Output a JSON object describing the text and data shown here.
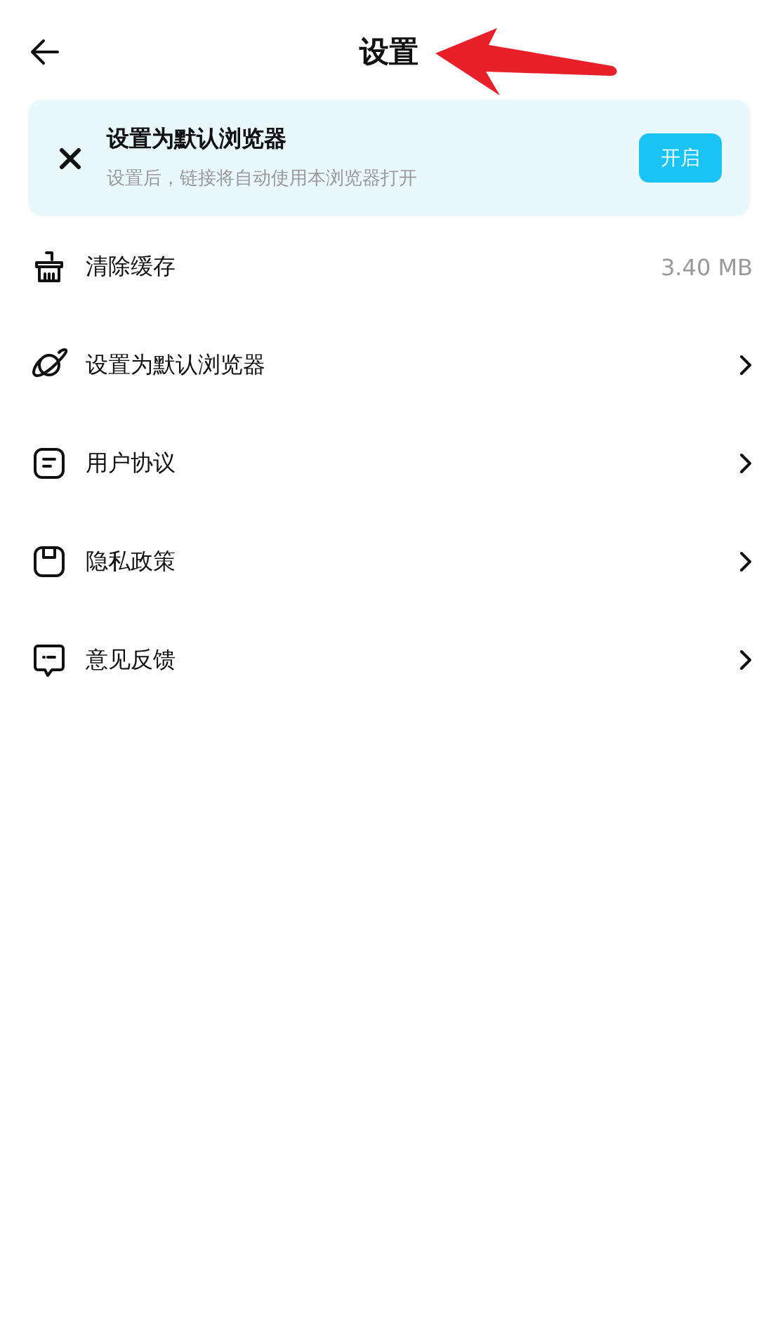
{
  "header": {
    "title": "设置"
  },
  "banner": {
    "title": "设置为默认浏览器",
    "subtitle": "设置后，链接将自动使用本浏览器打开",
    "button": "开启"
  },
  "items": [
    {
      "label": "清除缓存",
      "kind": "value",
      "value": "3.40 MB"
    },
    {
      "label": "设置为默认浏览器",
      "kind": "link"
    },
    {
      "label": "用户协议",
      "kind": "link"
    },
    {
      "label": "隐私政策",
      "kind": "link"
    },
    {
      "label": "意见反馈",
      "kind": "link"
    }
  ]
}
